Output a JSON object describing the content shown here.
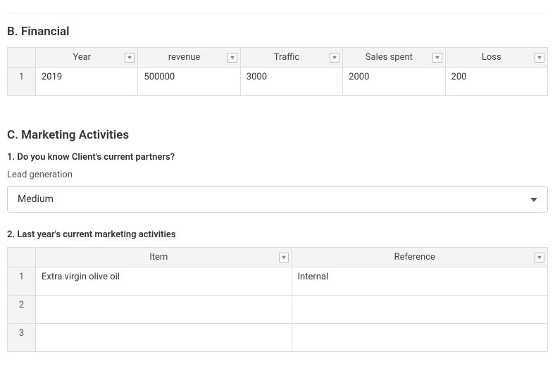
{
  "sectionB": {
    "title": "B. Financial",
    "table": {
      "headers": [
        "Year",
        "revenue",
        "Traffic",
        "Sales spent",
        "Loss"
      ],
      "rows": [
        {
          "num": "1",
          "cells": [
            "2019",
            "500000",
            "3000",
            "2000",
            "200"
          ]
        }
      ]
    }
  },
  "sectionC": {
    "title": "C. Marketing Activities",
    "q1": {
      "question": "1. Do you know Client's current partners?",
      "label": "Lead generation",
      "value": "Medium"
    },
    "q2": {
      "question": "2. Last year's current marketing activities",
      "table": {
        "headers": [
          "Item",
          "Reference"
        ],
        "rows": [
          {
            "num": "1",
            "cells": [
              "Extra virgin olive oil",
              "Internal"
            ]
          },
          {
            "num": "2",
            "cells": [
              "",
              ""
            ]
          },
          {
            "num": "3",
            "cells": [
              "",
              ""
            ]
          }
        ]
      }
    }
  }
}
